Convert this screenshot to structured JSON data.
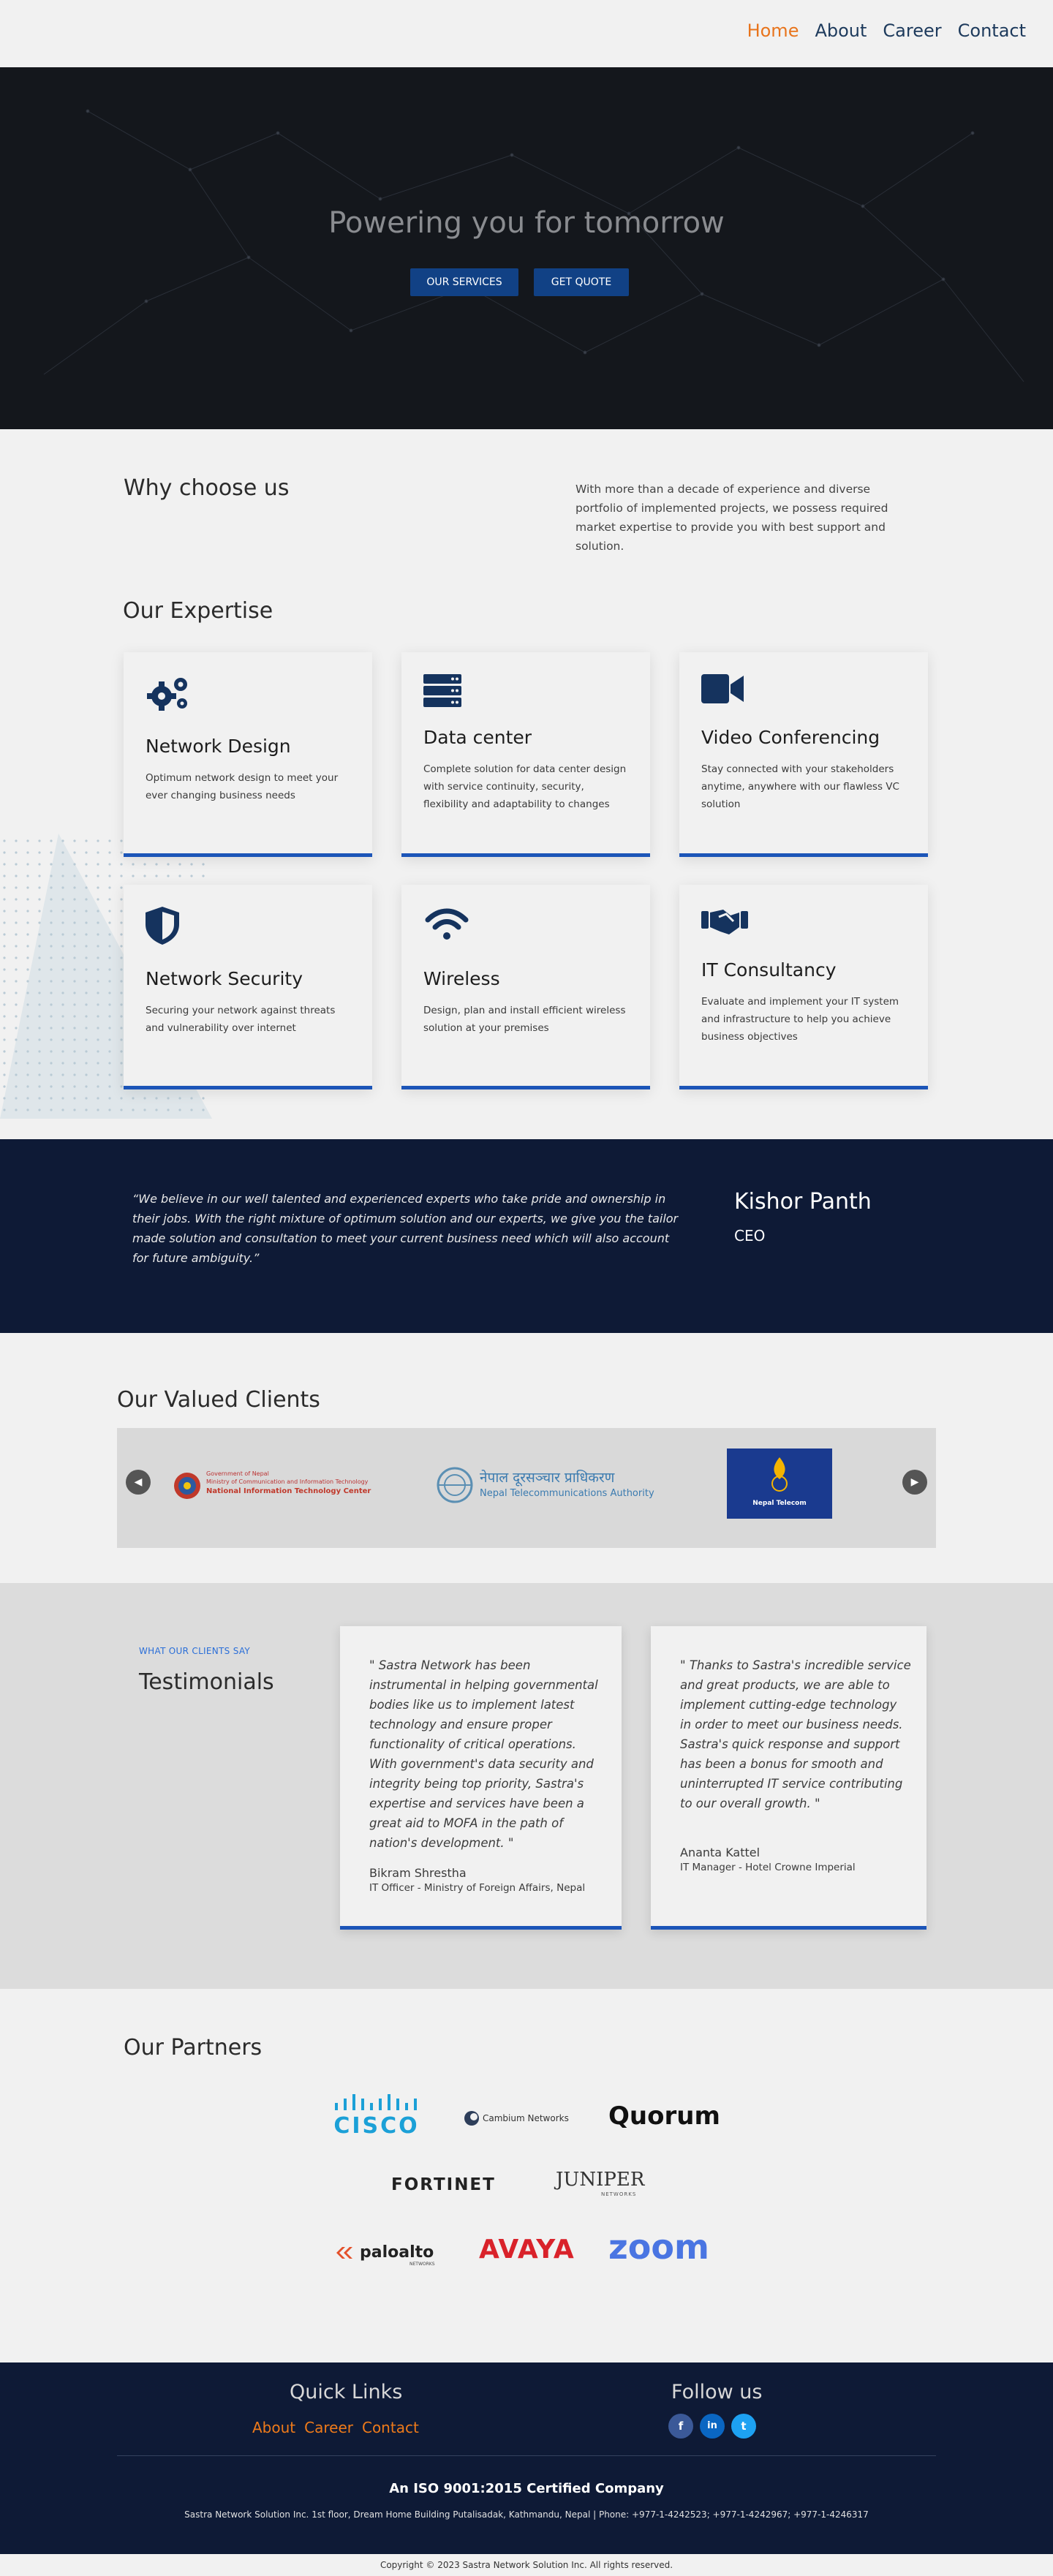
{
  "nav": {
    "items": [
      {
        "label": "Home"
      },
      {
        "label": "About"
      },
      {
        "label": "Career"
      },
      {
        "label": "Contact"
      }
    ]
  },
  "hero": {
    "title": "Powering you for tomorrow",
    "services_button": "OUR SERVICES",
    "quote_button": "GET QUOTE"
  },
  "why": {
    "title": "Why choose us",
    "text": "With more than a decade of experience and diverse portfolio of implemented projects, we possess required market expertise to provide you with best support and solution."
  },
  "expertise": {
    "title": "Our Expertise",
    "cards": [
      {
        "icon": "gears-icon",
        "title": "Network Design",
        "text": "Optimum network design to meet your ever changing  business  needs"
      },
      {
        "icon": "server-icon",
        "title": "Data center",
        "text": "Complete solution for data center design with service continuity, security, flexibility and adaptability to changes"
      },
      {
        "icon": "video-camera-icon",
        "title": "Video Conferencing",
        "text": "Stay connected with your stakeholders anytime, anywhere with our flawless VC solution"
      },
      {
        "icon": "shield-icon",
        "title": "Network Security",
        "text": "Securing your network against threats and vulnerability over internet"
      },
      {
        "icon": "wifi-icon",
        "title": "Wireless",
        "text": "Design, plan and install efficient wireless solution at your premises"
      },
      {
        "icon": "handshake-icon",
        "title": "IT Consultancy",
        "text": "Evaluate and implement your IT system and infrastructure to help you achieve business objectives"
      }
    ]
  },
  "ceo_quote": {
    "text": "“We believe in our well talented and experienced experts who take pride and ownership in their jobs. With the right mixture of optimum solution and our experts, we give you the tailor made solution and consultation to meet your current business need which will also account for future ambiguity.”",
    "name": "Kishor Panth",
    "role": "CEO"
  },
  "clients": {
    "title": "Our Valued Clients",
    "prev": "◀",
    "next": "▶",
    "logos": [
      {
        "line1": "Government of Nepal",
        "line2": "Ministry of Communication and Information Technology",
        "line3": "National Information Technology Center"
      },
      {
        "line1": "नेपाल दूरसञ्चार प्राधिकरण",
        "line2": "Nepal Telecommunications Authority"
      },
      {
        "line1": "Nepal Telecom"
      }
    ]
  },
  "testimonials": {
    "tag": "WHAT OUR CLIENTS SAY",
    "title": "Testimonials",
    "items": [
      {
        "lines": [
          "\" Sastra Network has been",
          "instrumental in helping governmental",
          "bodies like us to implement latest",
          "technology and ensure proper",
          "functionality of critical operations.",
          "With government's data security and",
          "integrity being top priority, Sastra's",
          "expertise and services have been a",
          "great aid to MOFA in the path of",
          "nation's development. \""
        ],
        "name": "Bikram Shrestha",
        "role": "IT Officer - Ministry of Foreign Affairs, Nepal"
      },
      {
        "lines": [
          "\" Thanks to Sastra's incredible service",
          "and great products, we are able to",
          "implement cutting-edge technology",
          "in order to meet our business needs.",
          "Sastra's quick response and support",
          "has been a bonus for smooth and",
          "uninterrupted IT service contributing",
          "to our overall growth. \""
        ],
        "name": "Ananta Kattel",
        "role": "IT Manager - Hotel Crowne Imperial"
      }
    ]
  },
  "partners": {
    "title": "Our Partners",
    "logos": [
      "CISCO",
      "Cambium Networks",
      "Quorum",
      "FORTINET",
      "JUNIPER",
      "NETWORKS",
      "paloalto",
      "NETWORKS",
      "AVAYA",
      "zoom"
    ]
  },
  "footer": {
    "quick_links_title": "Quick Links",
    "quick_links": [
      "About",
      "Career",
      "Contact"
    ],
    "follow_title": "Follow us",
    "social": [
      {
        "icon": "facebook-icon",
        "glyph": "f",
        "color": "#3b5998"
      },
      {
        "icon": "linkedin-icon",
        "glyph": "in",
        "color": "#0a66c2"
      },
      {
        "icon": "twitter-icon",
        "glyph": "t",
        "color": "#1da1f2"
      }
    ],
    "iso": "An ISO 9001:2015 Certified Company",
    "address": "Sastra Network Solution Inc. 1st floor, Dream Home Building Putalisadak, Kathmandu, Nepal | Phone: +977-1-4242523; +977-1-4242967; +977-1-4246317",
    "copyright": "Copyright © 2023 Sastra Network Solution Inc. All rights reserved."
  },
  "colors": {
    "accent": "#e8741c",
    "primary": "#114185",
    "navy": "#0e1a36",
    "card_border": "#1c55b8"
  }
}
